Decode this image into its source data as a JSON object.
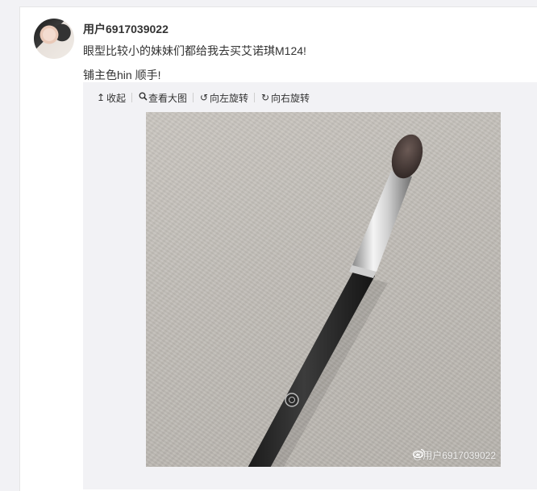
{
  "post": {
    "username": "用户6917039022",
    "line1": "眼型比较小的妹妹们都给我去买艾诺琪M124!",
    "line2": "铺主色hin 顺手!"
  },
  "toolbar": {
    "collapse_label": "收起",
    "view_large_label": "查看大图",
    "rotate_left_label": "向左旋转",
    "rotate_right_label": "向右旋转",
    "collapse_icon": "arrow-up-icon",
    "view_large_icon": "magnifier-icon",
    "rotate_left_icon": "rotate-left-icon",
    "rotate_right_icon": "rotate-right-icon"
  },
  "image": {
    "watermark": "@用户6917039022",
    "subject": "eyeshadow-brush"
  },
  "colors": {
    "text": "#333333",
    "media_bg": "#f2f2f5",
    "card_bg": "#ffffff"
  }
}
